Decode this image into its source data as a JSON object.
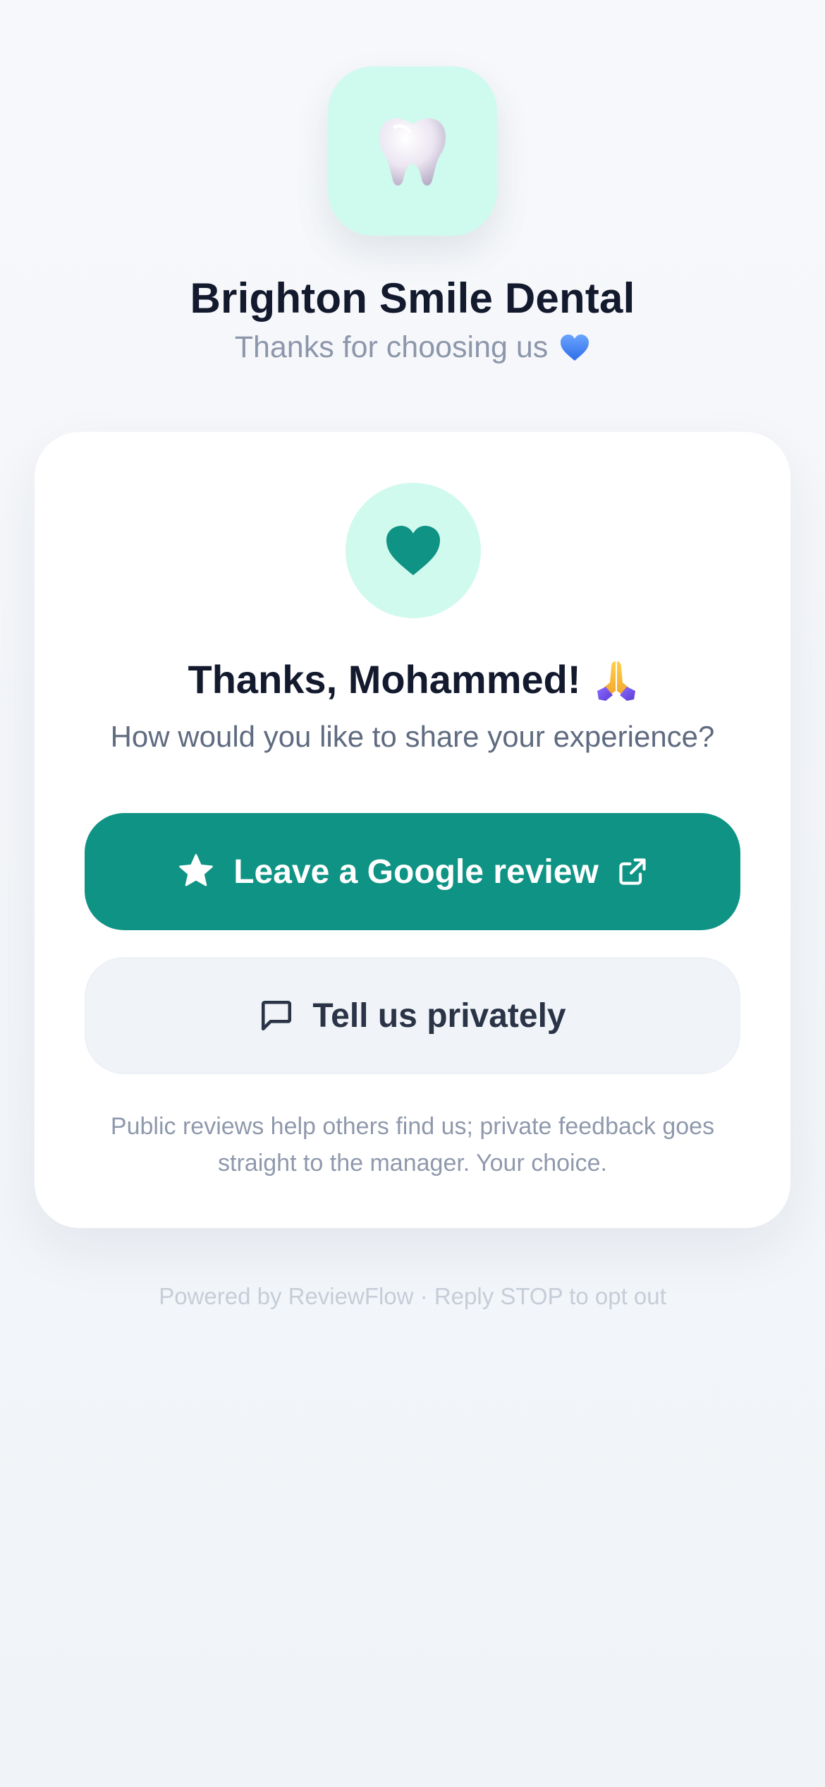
{
  "brand": {
    "name": "Brighton Smile Dental",
    "tagline": "Thanks for choosing us",
    "tagline_emoji": "blue-heart-icon",
    "logo_icon": "tooth-icon",
    "accent_color": "#cffaee"
  },
  "card": {
    "icon": "heart-icon",
    "title": "Thanks, Mohammed!",
    "title_emoji": "folded-hands-icon",
    "subtitle": "How would you like to share your experience?",
    "primary_button": {
      "label": "Leave a Google review",
      "leading_icon": "star-icon",
      "trailing_icon": "external-link-icon",
      "color": "#0e9384"
    },
    "secondary_button": {
      "label": "Tell us privately",
      "leading_icon": "message-icon"
    },
    "note": "Public reviews help others find us; private feedback goes straight to the manager. Your choice."
  },
  "footer": {
    "text": "Powered by ReviewFlow · Reply STOP to opt out"
  }
}
